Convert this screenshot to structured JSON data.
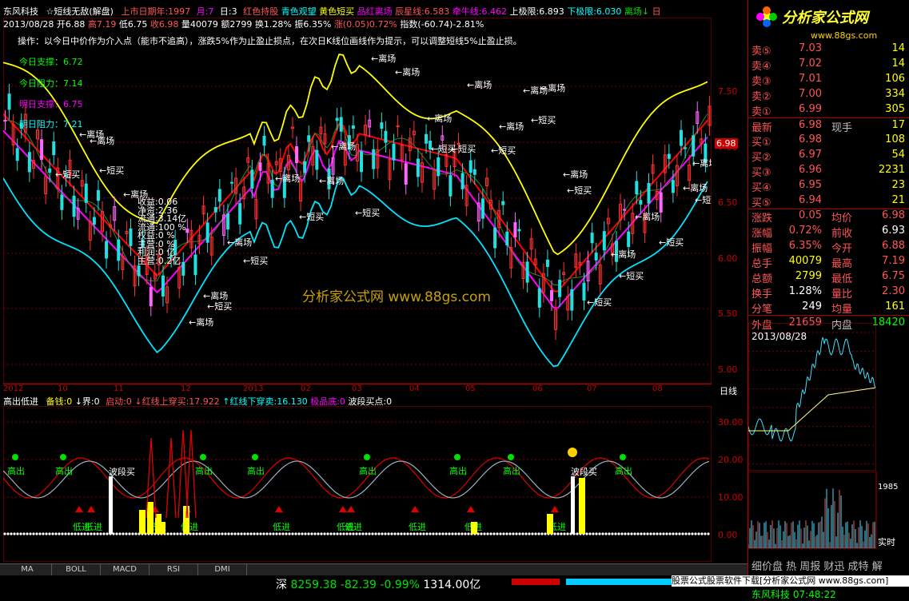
{
  "header": {
    "stock_name": "东风科技",
    "formula": "☆短线无敌(解盘)",
    "listing": "上市日期年",
    "listing_val": ":1997",
    "month": "月:7",
    "day": "日:3",
    "note_red": "红色持股",
    "note_cyan": "青色观望",
    "note_yellow": "黄色短买",
    "note_mag": "品红离场",
    "star_label": "辰星线:6.583",
    "bull_label": "牵牛线:6.462",
    "upper": "上极限:6.893",
    "lower": "下极限:6.030",
    "exit": "离场↓",
    "period": "日"
  },
  "header2": {
    "date": "2013/08/28",
    "open": "开6.88",
    "high": "高7.19",
    "low": "低6.75",
    "close": "收6.98",
    "vol": "量40079",
    "amount": "额2799",
    "turnover": "换1.28%",
    "amplitude": "振6.35%",
    "change": "涨(0.05)0.72%",
    "index": "指数(-60.74)-2.81%"
  },
  "notes": {
    "operation": "操作：以今日中价作为介入点（能市不追高），涨跌5%作为止盈止损点，在次日K线位画线作为提示，可以调整短线5%止盈止损。",
    "support_today": "今日支撑：6.72",
    "resist_today": "今日阻力：7.14",
    "support_tomorrow": "明日支撑：6.75",
    "resist_tomorrow": "明日阻力：7.21"
  },
  "stats": {
    "income": "收益:0.06",
    "net": "净资:2.36",
    "float": "流通:3.14亿",
    "float_ratio": "流通:100 %",
    "roe": "权益:0 %",
    "op": "主营:0 %",
    "profit": "利润:0 亿",
    "main": "主营:0.2亿"
  },
  "signal_labels": {
    "exit": "离场",
    "short_buy": "短买",
    "gao_chu": "高出",
    "di_jin": "低进",
    "wave_buy": "波段买"
  },
  "indicator_header": {
    "name": "高出低进",
    "bei": "备钱:0",
    "jie": "↓界:0",
    "start": "启动:0",
    "red_cross": "↓红线上穿买:17.922",
    "red_down": "↑红线下穿卖:16.130",
    "extreme": "极品底:0",
    "wave": "波段买点:0"
  },
  "price_axis": [
    "7.50",
    "7.00",
    "6.50",
    "6.00",
    "5.50",
    "5.00"
  ],
  "current_price_tag": "6.98",
  "date_axis": [
    "2012",
    "10",
    "11",
    "12",
    "2013",
    "02",
    "03",
    "04",
    "05",
    "06",
    "07",
    "08"
  ],
  "date_axis_right": "日线",
  "ind_axis": [
    "30.00",
    "20.00",
    "10.00",
    "0.00"
  ],
  "tabs": [
    "MA",
    "BOLL",
    "MACD",
    "RSI",
    "DMI"
  ],
  "logo": {
    "text": "分析家公式网",
    "url": "www.88gs.com"
  },
  "watermark": "分析家公式网 www.88gs.com",
  "order_book": {
    "sell": [
      {
        "label": "卖⑤",
        "price": "7.03",
        "vol": "14"
      },
      {
        "label": "卖④",
        "price": "7.02",
        "vol": "14"
      },
      {
        "label": "卖③",
        "price": "7.01",
        "vol": "106"
      },
      {
        "label": "卖②",
        "price": "7.00",
        "vol": "334"
      },
      {
        "label": "卖①",
        "price": "6.99",
        "vol": "305"
      }
    ],
    "latest_label": "最新",
    "latest": "6.98",
    "now_label": "现手",
    "now": "17",
    "buy": [
      {
        "label": "买①",
        "price": "6.98",
        "vol": "108"
      },
      {
        "label": "买②",
        "price": "6.97",
        "vol": "54"
      },
      {
        "label": "买③",
        "price": "6.96",
        "vol": "2231"
      },
      {
        "label": "买④",
        "price": "6.95",
        "vol": "23"
      },
      {
        "label": "买⑤",
        "price": "6.94",
        "vol": "21"
      }
    ]
  },
  "quote": [
    {
      "l1": "涨跌",
      "v1": "0.05",
      "l2": "均价",
      "v2": "6.98"
    },
    {
      "l1": "涨幅",
      "v1": "0.72%",
      "l2": "前收",
      "v2": "6.93"
    },
    {
      "l1": "振幅",
      "v1": "6.35%",
      "l2": "今开",
      "v2": "6.88"
    },
    {
      "l1": "总手",
      "v1": "40079",
      "l2": "最高",
      "v2": "7.19"
    },
    {
      "l1": "总额",
      "v1": "2799",
      "l2": "最低",
      "v2": "6.75"
    },
    {
      "l1": "换手",
      "v1": "1.28%",
      "l2": "量比",
      "v2": "2.30"
    },
    {
      "l1": "分笔",
      "v1": "249",
      "l2": "均量",
      "v2": "161"
    }
  ],
  "outer": {
    "label": "外盘",
    "val": "21659",
    "label2": "内盘",
    "val2": "18420"
  },
  "tick_date": "2013/08/28",
  "tick_axis": [
    "7.19",
    "7.13",
    "7.06",
    "6.99",
    "6.93",
    "6.86",
    "6.80",
    "6.73"
  ],
  "vol_axis_top": "1985",
  "realtime": "实时",
  "status": {
    "market": "深",
    "index": "8259.38",
    "change": "-82.39",
    "pct": "-0.99%",
    "amount": "1314.00亿",
    "ticker_right": "股票公式股票软件下载[分析家公式网 www.88gs.com]",
    "news": "细价盘 热 周报 财迅 成特 解",
    "time": "东风科技 07:48:22"
  },
  "colors": {
    "red": "#ff0000",
    "cyan": "#00ffff",
    "yellow": "#ffff00",
    "magenta": "#ff00ff",
    "green": "#00ff00",
    "grid": "#800000"
  }
}
